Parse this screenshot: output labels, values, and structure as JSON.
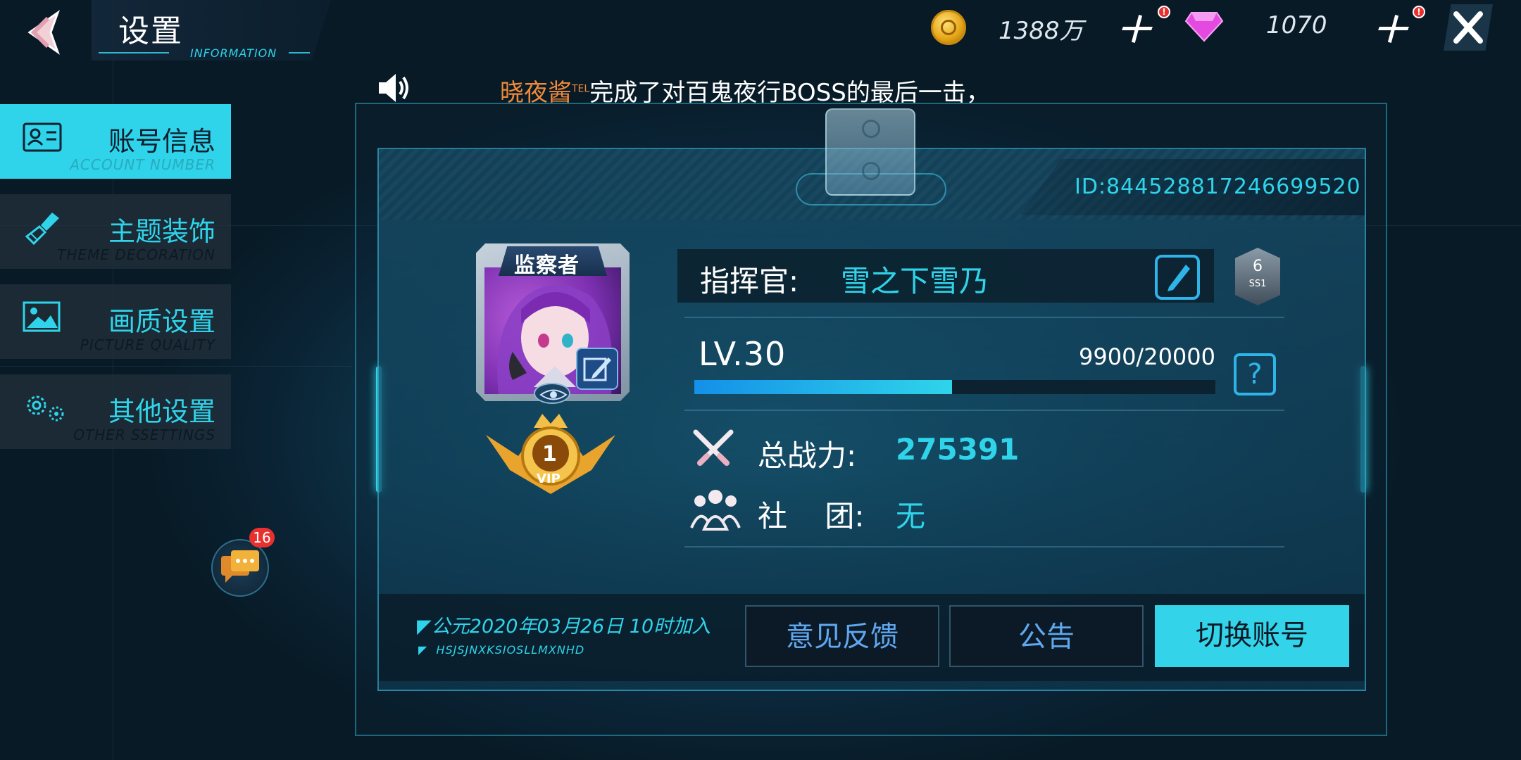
{
  "header": {
    "title": "设置",
    "subtitle": "INFORMATION",
    "gold": "1388万",
    "diamonds": "1070",
    "gold_alert": "!",
    "diamond_alert": "!"
  },
  "ticker": {
    "name": "晓夜酱",
    "tag": "TEL",
    "message": "完成了对百鬼夜行BOSS的最后一击，"
  },
  "menu": [
    {
      "label": "账号信息",
      "en": "ACCOUNT NUMBER",
      "icon": "id-card-icon",
      "active": true
    },
    {
      "label": "主题装饰",
      "en": "THEME DECORATION",
      "icon": "brush-icon",
      "active": false
    },
    {
      "label": "画质设置",
      "en": "PICTURE QUALITY",
      "icon": "picture-icon",
      "active": false
    },
    {
      "label": "其他设置",
      "en": "OTHER SSETTINGS",
      "icon": "gears-icon",
      "active": false
    }
  ],
  "chat": {
    "unread": "16"
  },
  "profile": {
    "id": "ID:844528817246699520",
    "avatar_tag": "监察者",
    "vip_level": "1",
    "vip_label": "VIP",
    "commander_label": "指挥官:",
    "commander_name": "雪之下雪乃",
    "rank_num": "6",
    "rank_tier": "SS1",
    "level": "LV.30",
    "exp": "9900/20000",
    "exp_fraction": 0.495,
    "power_label": "总战力:",
    "power_value": "275391",
    "guild_label": "社    团:",
    "guild_value": "无",
    "help": "?"
  },
  "footer": {
    "join_date": "公元2020年03月26日 10时加入",
    "join_code": "HSJSJNXKSIOSLLMXNHD",
    "buttons": {
      "feedback": "意见反馈",
      "notice": "公告",
      "switch": "切换账号"
    }
  },
  "colors": {
    "accent": "#2fd4ea",
    "ticker_name": "#f08a3a",
    "badge": "#e8312f"
  }
}
